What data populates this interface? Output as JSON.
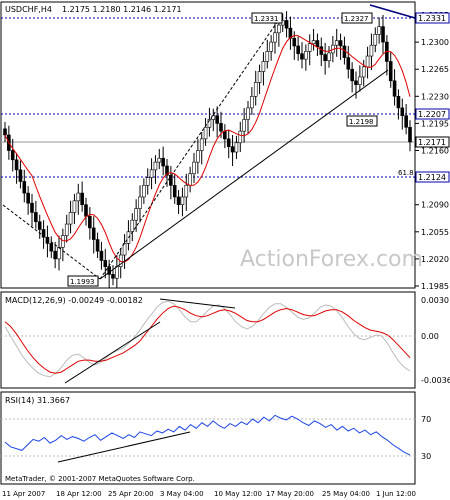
{
  "chart_data": [
    {
      "type": "candlestick",
      "symbol_label": "USDCHF,H4",
      "ohlc_header": "1.2175 1.2180 1.2146 1.2171",
      "ylim": [
        1.195,
        1.2345
      ],
      "yticks": [
        "1.2335",
        "1.2300",
        "1.2265",
        "1.2230",
        "1.2195",
        "1.2160",
        "1.2125",
        "1.2090",
        "1.2055",
        "1.2020",
        "1.1985"
      ],
      "hlines": [
        {
          "value": 1.2331,
          "label": "1.2331",
          "style": "dotted-blue"
        },
        {
          "value": 1.2207,
          "label": "1.2207",
          "style": "dotted-blue"
        },
        {
          "value": 1.2171,
          "label": "1.2171",
          "style": "solid-gray"
        },
        {
          "value": 1.2124,
          "label": "1.2124",
          "style": "dotted-blue"
        }
      ],
      "annotations": [
        "1.2331",
        "1.2327",
        "1.2198",
        "1.1993",
        "61.8"
      ],
      "watermark": "ActionForex.com",
      "closes": [
        1.218,
        1.216,
        1.2148,
        1.2135,
        1.212,
        1.2105,
        1.2092,
        1.208,
        1.2068,
        1.2058,
        1.2048,
        1.204,
        1.203,
        1.202,
        1.2035,
        1.205,
        1.2065,
        1.208,
        1.2095,
        1.2105,
        1.209,
        1.2075,
        1.206,
        1.2045,
        1.203,
        1.2018,
        1.201,
        1.2,
        1.1995,
        1.201,
        1.2025,
        1.204,
        1.2055,
        1.207,
        1.2085,
        1.21,
        1.2115,
        1.2125,
        1.2135,
        1.2145,
        1.215,
        1.214,
        1.2128,
        1.2115,
        1.21,
        1.209,
        1.21,
        1.2115,
        1.213,
        1.2145,
        1.216,
        1.2175,
        1.219,
        1.22,
        1.2205,
        1.2195,
        1.2185,
        1.2175,
        1.2165,
        1.2158,
        1.217,
        1.2185,
        1.22,
        1.2215,
        1.223,
        1.2248,
        1.2262,
        1.2275,
        1.2288,
        1.23,
        1.2312,
        1.2322,
        1.2328,
        1.2318,
        1.2305,
        1.2295,
        1.2285,
        1.2278,
        1.2288,
        1.2298,
        1.2302,
        1.2294,
        1.2284,
        1.2276,
        1.2286,
        1.2296,
        1.2302,
        1.2295,
        1.228,
        1.2265,
        1.225,
        1.2245,
        1.2255,
        1.2268,
        1.2282,
        1.2296,
        1.231,
        1.232,
        1.23,
        1.2275,
        1.225,
        1.223,
        1.2215,
        1.2205,
        1.219,
        1.2171
      ]
    },
    {
      "type": "line",
      "title": "MACD(12,26,9) -0.00249 -0.00182",
      "yticks": [
        "0.00301",
        "0.00",
        "-0.00366"
      ],
      "series": [
        {
          "name": "MACD"
        },
        {
          "name": "Signal"
        }
      ],
      "values_main": [
        0.0008,
        0.0,
        -0.0008,
        -0.0016,
        -0.0022,
        -0.0027,
        -0.0031,
        -0.0033,
        -0.0034,
        -0.0031,
        -0.0026,
        -0.002,
        -0.0016,
        -0.0015,
        -0.0018,
        -0.0022,
        -0.0024,
        -0.0022,
        -0.0018,
        -0.0014,
        -0.0012,
        -0.001,
        -0.0006,
        -0.0001,
        0.0005,
        0.0012,
        0.0018,
        0.0024,
        0.0028,
        0.0029,
        0.0027,
        0.0022,
        0.0016,
        0.0012,
        0.0012,
        0.0016,
        0.0021,
        0.0025,
        0.0026,
        0.0023,
        0.0018,
        0.0012,
        0.0008,
        0.0006,
        0.0008,
        0.0013,
        0.0019,
        0.0024,
        0.0027,
        0.0027,
        0.0024,
        0.002,
        0.0016,
        0.0014,
        0.0015,
        0.0019,
        0.0024,
        0.0026,
        0.0025,
        0.0021,
        0.0015,
        0.0008,
        0.0002,
        -0.0002,
        -0.0003,
        -0.0001,
        0.0001,
        0.0,
        -0.0006,
        -0.0014,
        -0.0021,
        -0.0026,
        -0.0029
      ],
      "values_signal": [
        0.0012,
        0.0008,
        0.0002,
        -0.0005,
        -0.0012,
        -0.0018,
        -0.0023,
        -0.0027,
        -0.003,
        -0.0031,
        -0.003,
        -0.0027,
        -0.0024,
        -0.0021,
        -0.002,
        -0.002,
        -0.0021,
        -0.0021,
        -0.002,
        -0.0018,
        -0.0016,
        -0.0014,
        -0.0011,
        -0.0008,
        -0.0004,
        0.0002,
        0.0008,
        0.0014,
        0.0019,
        0.0023,
        0.0025,
        0.0024,
        0.0022,
        0.0019,
        0.0017,
        0.0016,
        0.0017,
        0.0019,
        0.0021,
        0.0022,
        0.0021,
        0.0019,
        0.0016,
        0.0013,
        0.0012,
        0.0012,
        0.0014,
        0.0017,
        0.002,
        0.0022,
        0.0023,
        0.0022,
        0.002,
        0.0018,
        0.0017,
        0.0017,
        0.0019,
        0.0021,
        0.0022,
        0.0022,
        0.002,
        0.0017,
        0.0013,
        0.001,
        0.0007,
        0.0005,
        0.0004,
        0.0003,
        0.0001,
        -0.0003,
        -0.0008,
        -0.0013,
        -0.0018
      ]
    },
    {
      "type": "line",
      "title": "RSI(14) 31.3667",
      "yticks": [
        "70",
        "30"
      ],
      "values": [
        45,
        40,
        38,
        36,
        42,
        48,
        46,
        50,
        44,
        47,
        52,
        48,
        51,
        49,
        46,
        50,
        53,
        47,
        51,
        55,
        52,
        49,
        53,
        50,
        56,
        54,
        52,
        57,
        55,
        59,
        56,
        62,
        58,
        64,
        60,
        66,
        62,
        68,
        63,
        60,
        65,
        62,
        67,
        64,
        70,
        66,
        72,
        68,
        74,
        71,
        69,
        73,
        70,
        66,
        63,
        68,
        65,
        61,
        64,
        58,
        62,
        57,
        60,
        55,
        58,
        53,
        56,
        51,
        47,
        42,
        38,
        34,
        31
      ]
    }
  ],
  "xlabels": [
    "11 Apr 2007",
    "18 Apr 12:00",
    "25 Apr 20:00",
    "3 May 04:00",
    "10 May 12:00",
    "17 May 20:00",
    "25 May 04:00",
    "1 Jun 12:00"
  ],
  "footer": "MetaTrader, © 2001-2007 MetaQuotes Software Corp.",
  "colors": {
    "up": "#000000",
    "ma": "#e00000",
    "hline": "#0000aa",
    "trend": "#000000",
    "rsi": "#1e46e6",
    "level": "#bbbbbb"
  }
}
